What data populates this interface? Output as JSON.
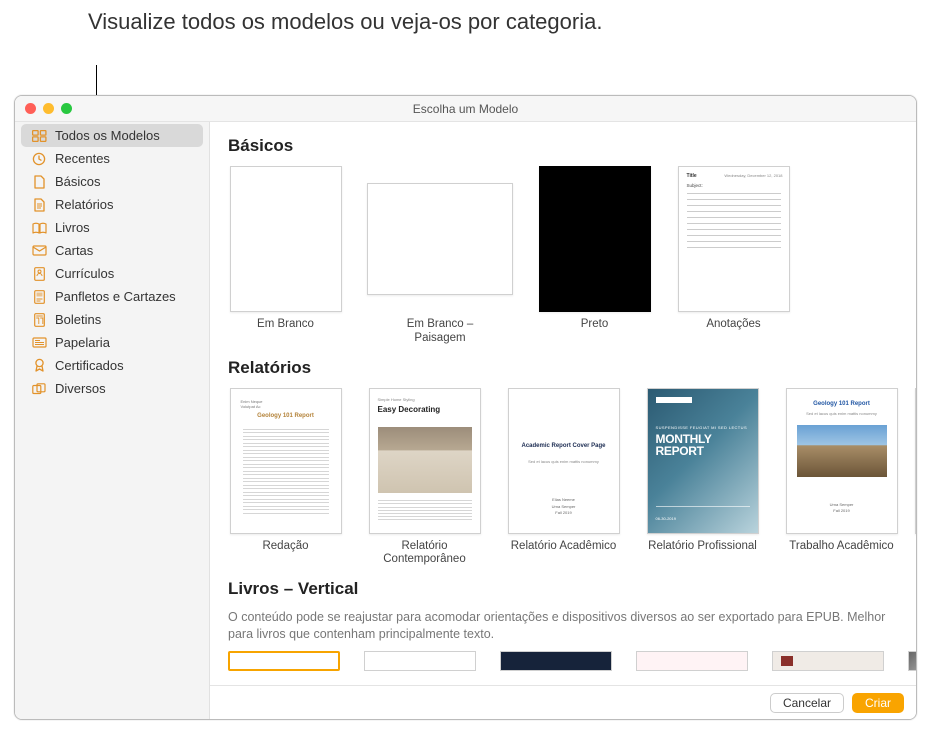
{
  "callout": "Visualize todos os modelos ou veja-os por categoria.",
  "window_title": "Escolha um Modelo",
  "sidebar": {
    "items": [
      {
        "label": "Todos os Modelos",
        "icon": "grid"
      },
      {
        "label": "Recentes",
        "icon": "clock"
      },
      {
        "label": "Básicos",
        "icon": "doc"
      },
      {
        "label": "Relatórios",
        "icon": "doc-text"
      },
      {
        "label": "Livros",
        "icon": "book"
      },
      {
        "label": "Cartas",
        "icon": "envelope"
      },
      {
        "label": "Currículos",
        "icon": "person"
      },
      {
        "label": "Panfletos e Cartazes",
        "icon": "poster"
      },
      {
        "label": "Boletins",
        "icon": "columns"
      },
      {
        "label": "Papelaria",
        "icon": "stationery"
      },
      {
        "label": "Certificados",
        "icon": "badge"
      },
      {
        "label": "Diversos",
        "icon": "diverse"
      }
    ],
    "selected_index": 0
  },
  "sections": {
    "basics": {
      "title": "Básicos",
      "items": [
        "Em Branco",
        "Em Branco – Paisagem",
        "Preto",
        "Anotações"
      ]
    },
    "reports": {
      "title": "Relatórios",
      "items": [
        "Redação",
        "Relatório Contemporâneo",
        "Relatório Acadêmico",
        "Relatório Profissional",
        "Trabalho Acadêmico"
      ]
    },
    "books": {
      "title": "Livros – Vertical",
      "subtitle": "O conteúdo pode se reajustar para acomodar orientações e dispositivos diversos ao ser exportado para EPUB. Melhor para livros que contenham principalmente texto."
    }
  },
  "thumb_text": {
    "annot_title": "Title",
    "annot_date": "Wednesday, December 12, 2018",
    "annot_subject": "Subject:",
    "redacao_title": "Geology 101 Report",
    "contemp_small": "Simple Home Styling",
    "contemp_big": "Easy Decorating",
    "academic_title": "Academic Report Cover Page",
    "academic_sub": "Sed et lacus quis enim mattis nonummy",
    "pro_small": "SUSPENDISSE FEUGIAT MI SED LECTUS",
    "pro_big1": "MONTHLY",
    "pro_big2": "REPORT",
    "trabalho_title": "Geology 101 Report"
  },
  "footer": {
    "cancel": "Cancelar",
    "create": "Criar"
  },
  "colors": {
    "accent": "#f9a400",
    "sidebar_selected": "#d9d9d9"
  }
}
